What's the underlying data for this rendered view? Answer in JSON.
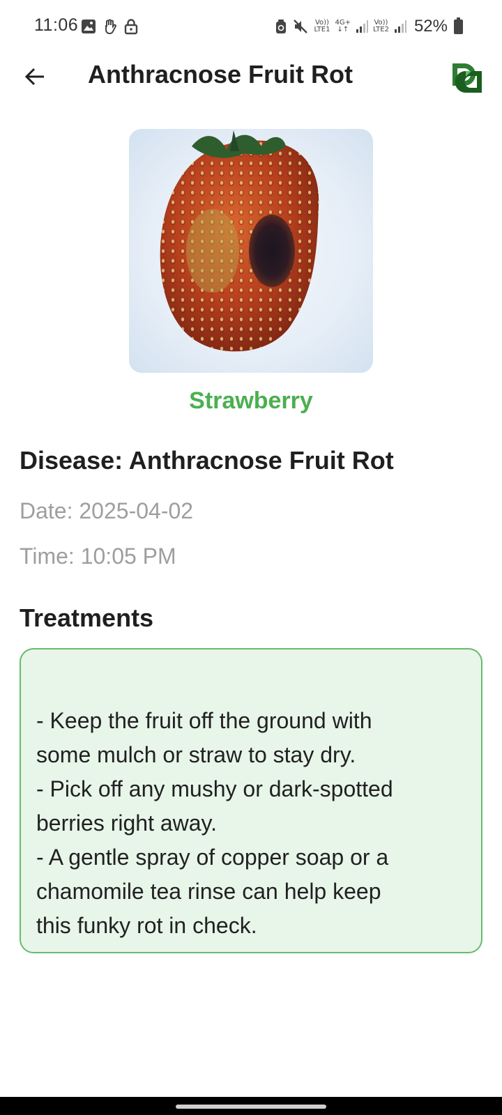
{
  "status_bar": {
    "time": "11:06",
    "net1_top": "Vo))",
    "net1_bottom": "LTE1",
    "net_type": "4G+",
    "net2_top": "Vo))",
    "net2_bottom": "LTE2",
    "battery": "52%"
  },
  "header": {
    "title": "Anthracnose Fruit Rot"
  },
  "detail": {
    "crop": "Strawberry",
    "disease": "Disease: Anthracnose Fruit Rot",
    "date": "Date: 2025-04-02",
    "time": "Time: 10:05 PM"
  },
  "treatments": {
    "heading": "Treatments",
    "lines": [
      "- Keep the fruit off the ground with",
      "some mulch or straw to stay dry.",
      "- Pick off any mushy or dark-spotted",
      "berries right away.",
      "- A gentle spray of copper soap or a",
      "chamomile tea rinse can help keep",
      "this funky rot in check."
    ]
  },
  "colors": {
    "accent": "#4caf50",
    "treatment_bg": "#e8f5e9",
    "treatment_border": "#66bb6a",
    "muted_text": "#9e9e9e"
  }
}
